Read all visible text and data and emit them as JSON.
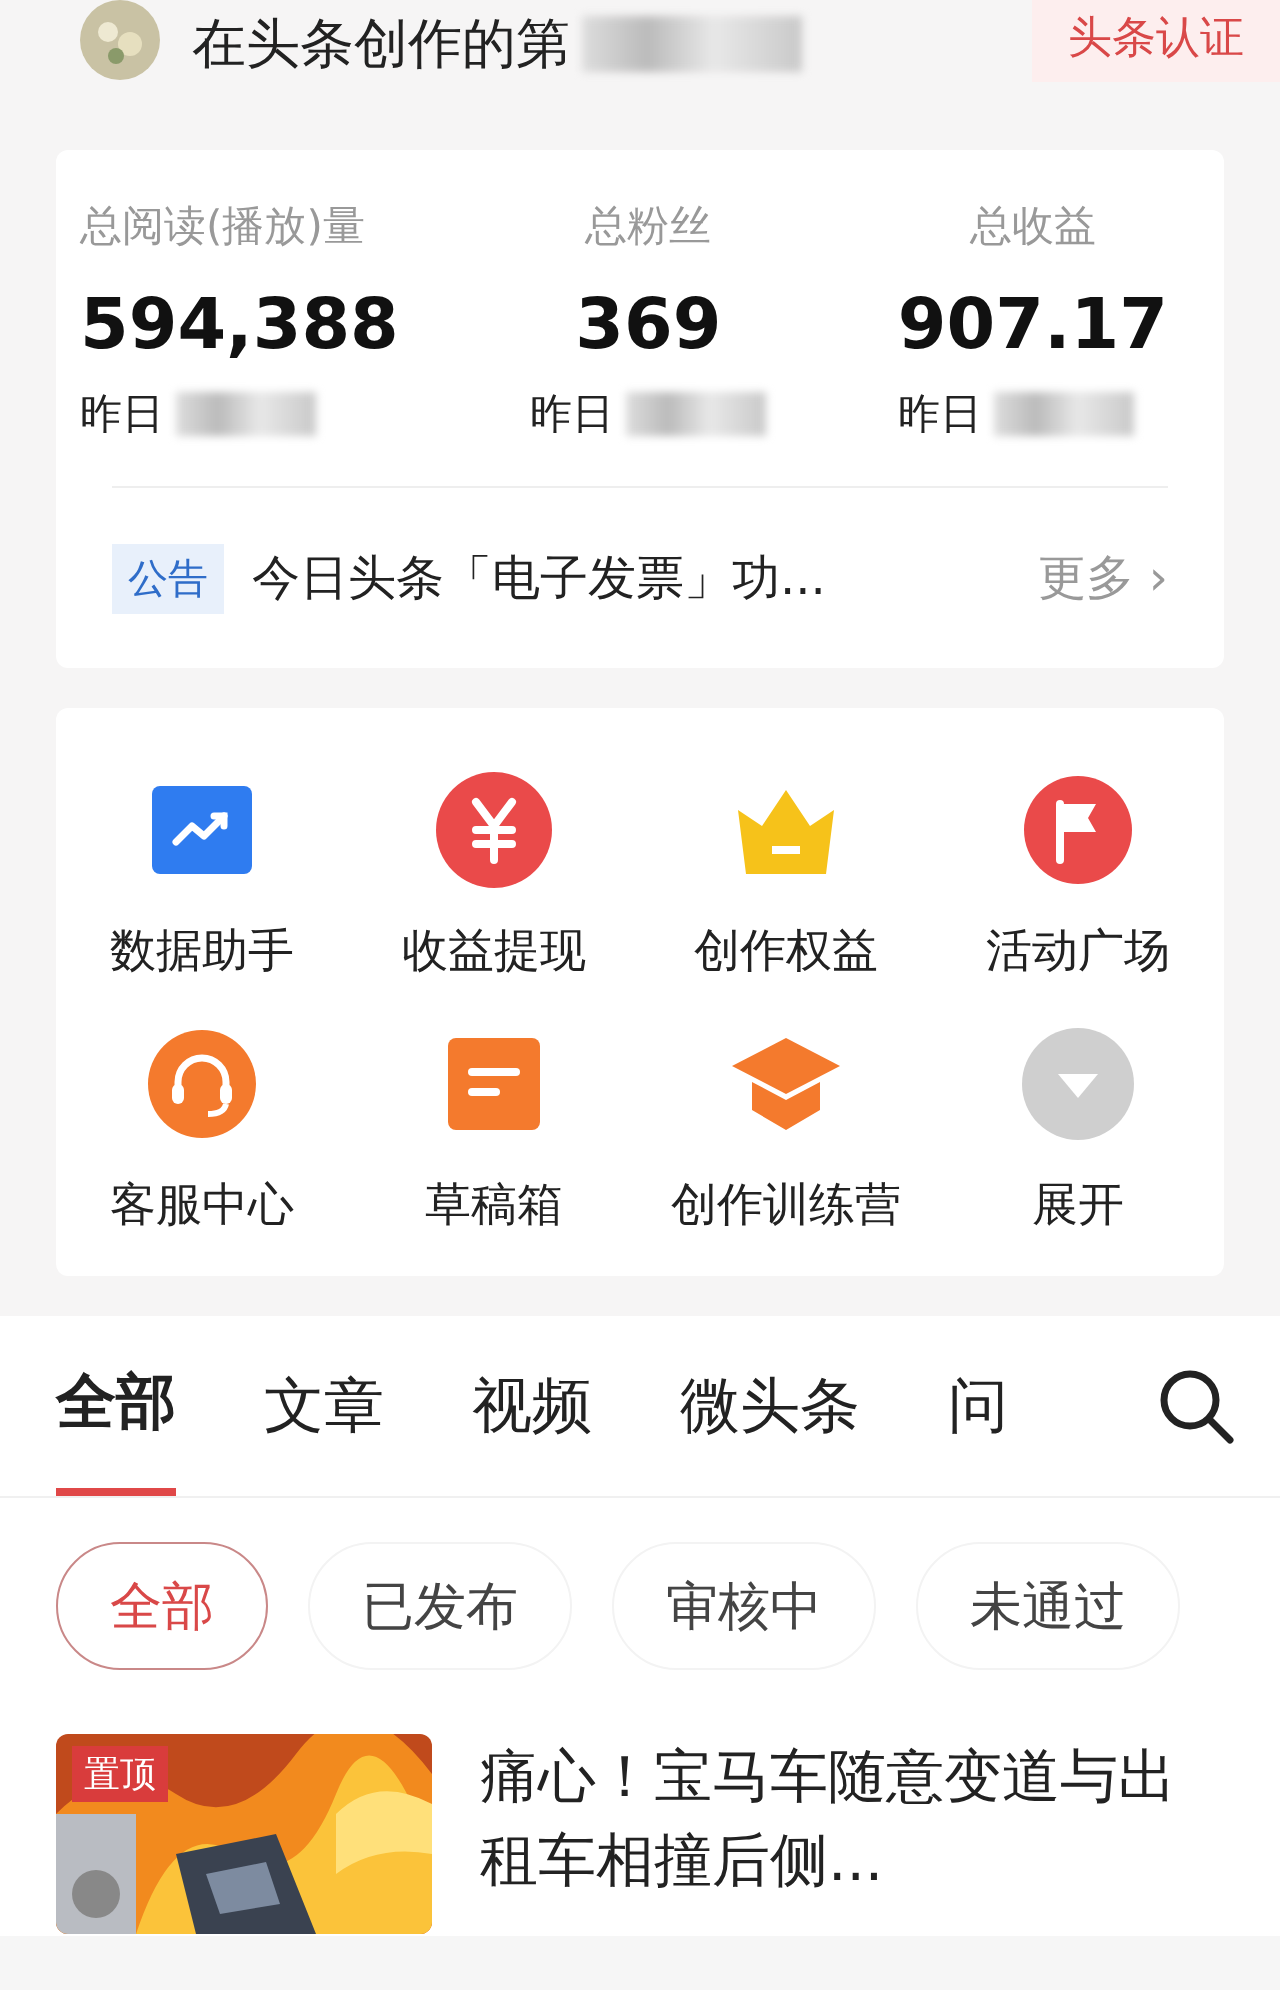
{
  "header": {
    "title": "在头条创作的第",
    "badge": "头条认证"
  },
  "stats": [
    {
      "label": "总阅读(播放)量",
      "value": "594,388",
      "yesterday": "昨日"
    },
    {
      "label": "总粉丝",
      "value": "369",
      "yesterday": "昨日"
    },
    {
      "label": "总收益",
      "value": "907.17",
      "yesterday": "昨日"
    }
  ],
  "notice": {
    "tag": "公告",
    "text": "今日头条「电子发票」功...",
    "more": "更多",
    "arrow": "›"
  },
  "tools": [
    {
      "kind": "chart",
      "label": "数据助手"
    },
    {
      "kind": "yuan",
      "label": "收益提现"
    },
    {
      "kind": "crown",
      "label": "创作权益"
    },
    {
      "kind": "flag",
      "label": "活动广场"
    },
    {
      "kind": "headset",
      "label": "客服中心"
    },
    {
      "kind": "draft",
      "label": "草稿箱"
    },
    {
      "kind": "cap",
      "label": "创作训练营"
    },
    {
      "kind": "expand",
      "label": "展开"
    }
  ],
  "tabs": [
    {
      "label": "全部",
      "selected": true
    },
    {
      "label": "文章",
      "selected": false
    },
    {
      "label": "视频",
      "selected": false
    },
    {
      "label": "微头条",
      "selected": false
    },
    {
      "label": "问",
      "selected": false
    }
  ],
  "filters": [
    {
      "label": "全部",
      "selected": true
    },
    {
      "label": "已发布",
      "selected": false
    },
    {
      "label": "审核中",
      "selected": false
    },
    {
      "label": "未通过",
      "selected": false
    }
  ],
  "article": {
    "pin": "置顶",
    "title": "痛心！宝马车随意变道与出租车相撞后侧..."
  }
}
